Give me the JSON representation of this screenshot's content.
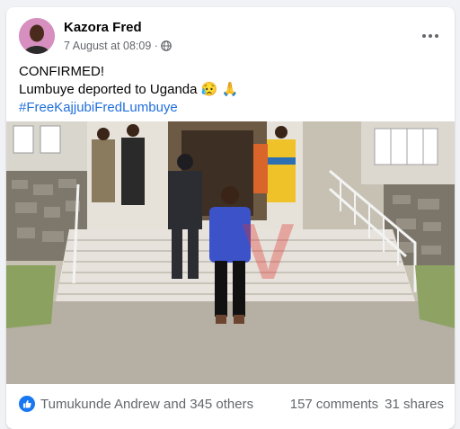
{
  "post": {
    "author": "Kazora Fred",
    "timestamp": "7 August at 08:09 ·",
    "privacy_icon": "globe-icon",
    "text_line1": "CONFIRMED!",
    "text_line2": "Lumbuye deported to Uganda 😥 🙏",
    "hashtag": "#FreeKajjubiFredLumbuye",
    "photo_watermark": "V"
  },
  "reactions": {
    "icon": "like-icon",
    "summary": "Tumukunde Andrew and 345 others",
    "comments": "157 comments",
    "shares": "31 shares"
  },
  "colors": {
    "link": "#216fdb",
    "like": "#1877f2",
    "secondary_text": "#65676b"
  }
}
